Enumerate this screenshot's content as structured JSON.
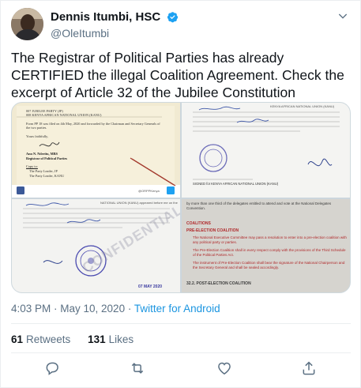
{
  "user": {
    "display_name": "Dennis Itumbi, HSC",
    "handle": "@OleItumbi"
  },
  "tweet": {
    "text": "The Registrar of Political Parties has already CERTIFIED the illegal Coalition Agreement. Check the excerpt of Article 32 of the Jubilee Constitution"
  },
  "media": {
    "panel1": {
      "row1": "007   JUBILEE PARTY (JP)",
      "row2": "008   KENYA AFRICAN NATIONAL UNION (KANU)",
      "body": "Form PP 18 was filed on 4th May, 2020 and forwarded by the Chairman and Secretary Generals of the two parties.",
      "faithfully": "Yours faithfully,",
      "signer": "Ann N. Nderitu, MBS",
      "title": "Registrar of Political Parties",
      "copy_to": "Copy to:",
      "cc1": "The Party Leader, JP",
      "cc2": "The Party Leader, KANU",
      "handle": "@ORPPKenya"
    },
    "panel2": {
      "line1": "KENYA AFRICAN NATIONAL UNION (KANU)",
      "footer": "SIGNED for KENYA AFRICAN NATIONAL UNION (KANU)"
    },
    "panel3": {
      "line1": "NATIONAL UNION (KANU) appeared before me on the",
      "stamp_date": "07 MAY 2020",
      "watermark": "CONFIDENTIAL"
    },
    "panel4": {
      "top": "by more than one third of the delegates entitled to attend and vote at the National Delegates Convention.",
      "heading1": "COALITIONS",
      "heading2": "PRE-ELECTION COALITION",
      "p1": "The National Executive Committee may pass a resolution to enter into a pre-election coalition with any political party or parties.",
      "p2": "The Pre-Election Coalition shall in every respect comply with the provisions of the Third Schedule of the Political Parties Act.",
      "p3": "The instrument of Pre-Election Coalition shall bear the signature of the National Chairperson and the Secretary General and shall be sealed accordingly.",
      "heading3": "32.2. POST-ELECTION COALITION"
    }
  },
  "meta": {
    "time": "4:03 PM · May 10, 2020",
    "separator": " · ",
    "source": "Twitter for Android"
  },
  "stats": {
    "retweets_count": "61",
    "retweets_label": "Retweets",
    "likes_count": "131",
    "likes_label": "Likes"
  },
  "icons": {
    "verified": "verified-badge-icon",
    "caret": "chevron-down-icon",
    "reply": "reply-icon",
    "retweet": "retweet-icon",
    "like": "heart-icon",
    "share": "share-icon"
  },
  "colors": {
    "accent": "#1da1f2",
    "link": "#1b95e0",
    "muted": "#5b7083"
  }
}
